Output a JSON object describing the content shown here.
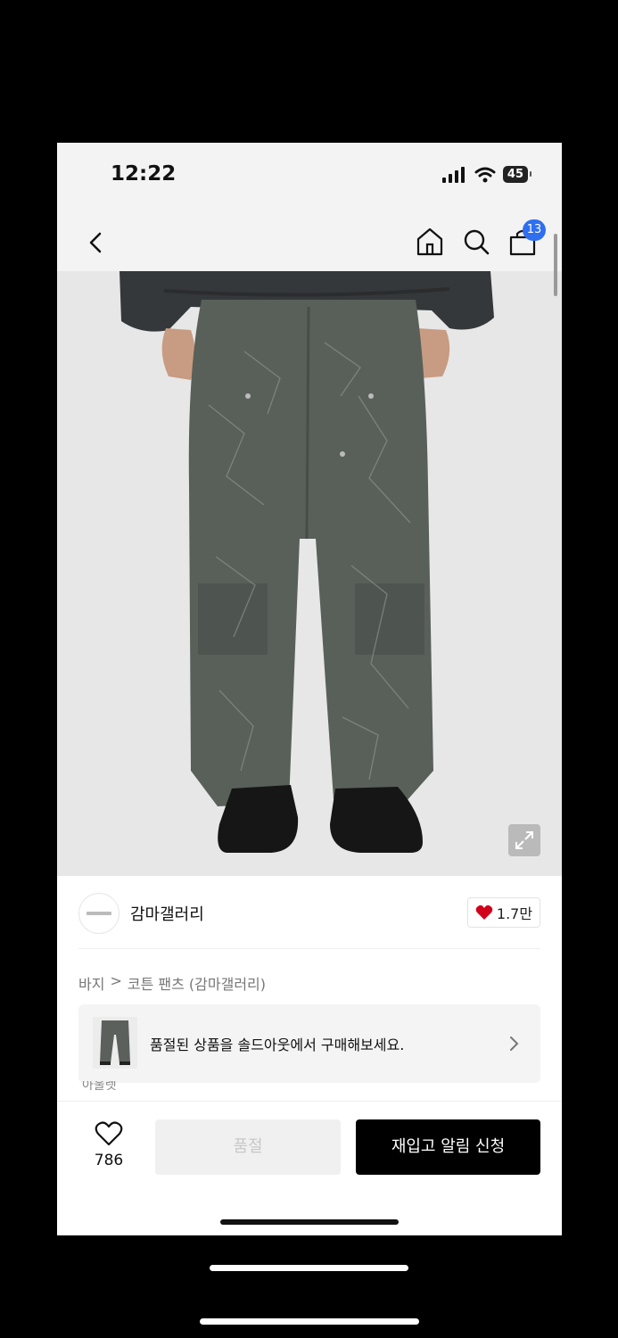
{
  "status_bar": {
    "time": "12:22",
    "battery": "45"
  },
  "nav": {
    "cart_count": "13",
    "icons": [
      "back-icon",
      "home-icon",
      "search-icon",
      "shopping-bag-icon"
    ]
  },
  "product": {
    "image_description": "grey washed wide-leg carpenter pants worn with black boots",
    "brand": {
      "name": "감마갤러리",
      "likes": "1.7만"
    },
    "breadcrumb": {
      "category": "바지",
      "separator": ">",
      "item": "코튼 팬츠 (감마갤러리)"
    },
    "soldout_banner": {
      "text": "품절된 상품을 솔드아웃에서 구매해보세요."
    },
    "cutoff_text": "아울렛"
  },
  "bottom_bar": {
    "wish_count": "786",
    "soldout_label": "품절",
    "restock_label": "재입고 알림 신청"
  },
  "colors": {
    "badge": "#2f6fef",
    "heart": "#d0021b",
    "primary_button": "#000000",
    "disabled_button": "#f0f0f1"
  }
}
